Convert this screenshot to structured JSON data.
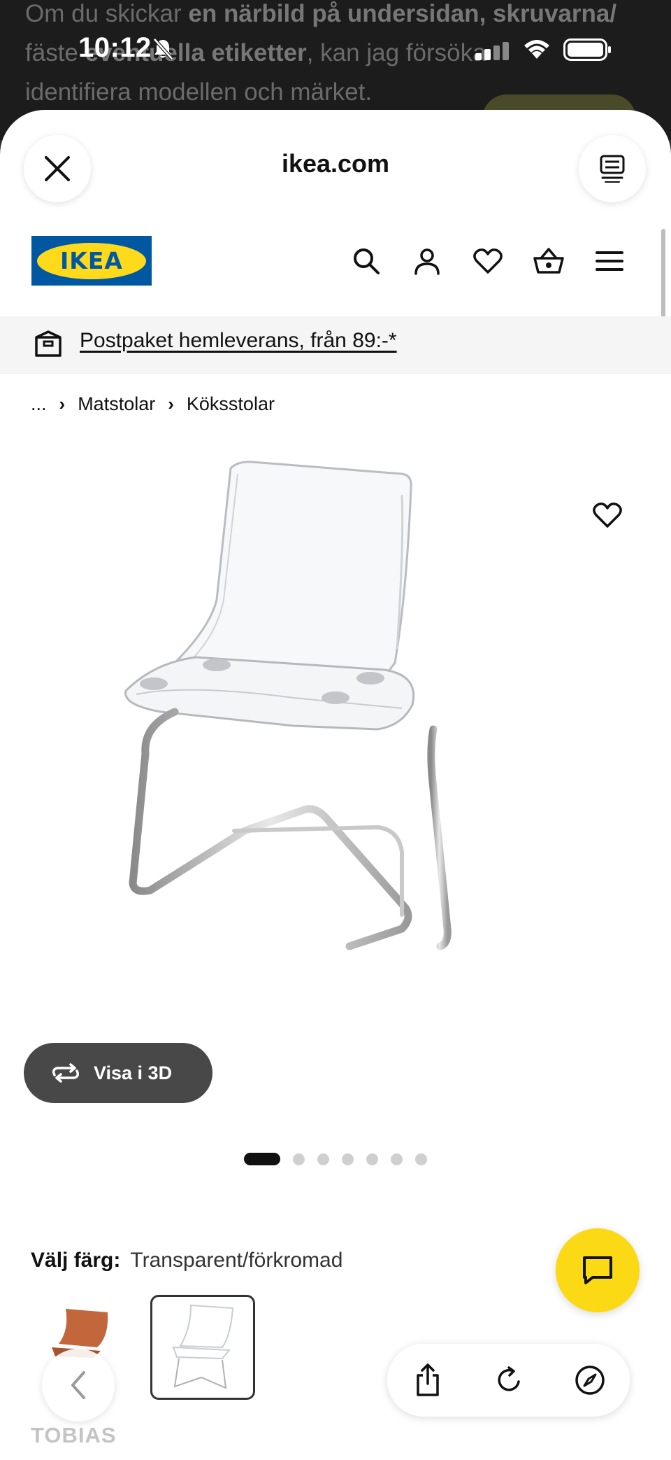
{
  "background_page": {
    "line1_prefix": "Om du skickar ",
    "line1_bold": "en närbild på undersidan, skruvarna/",
    "line2_prefix": "fäste",
    "line2_bold": "eventuella etiketter",
    "line2_suffix": ", kan jag försöka",
    "line3": "identifiera modellen och märket."
  },
  "status_bar": {
    "time": "10:12"
  },
  "browser": {
    "domain": "ikea.com"
  },
  "ikea": {
    "logo_text": "IKEA",
    "promo_link": "Postpaket hemleverans, från 89:-*",
    "breadcrumb": [
      "...",
      "Matstolar",
      "Köksstolar"
    ]
  },
  "product": {
    "view3d_label": "Visa i 3D",
    "image_count": 7,
    "active_image": 1,
    "color_label": "Välj färg:",
    "color_value": "Transparent/förkromad",
    "name": "TOBIAS"
  },
  "colors": {
    "ikea_blue": "#0058a3",
    "ikea_yellow": "#ffda1a",
    "chat_yellow": "#fbd914"
  }
}
